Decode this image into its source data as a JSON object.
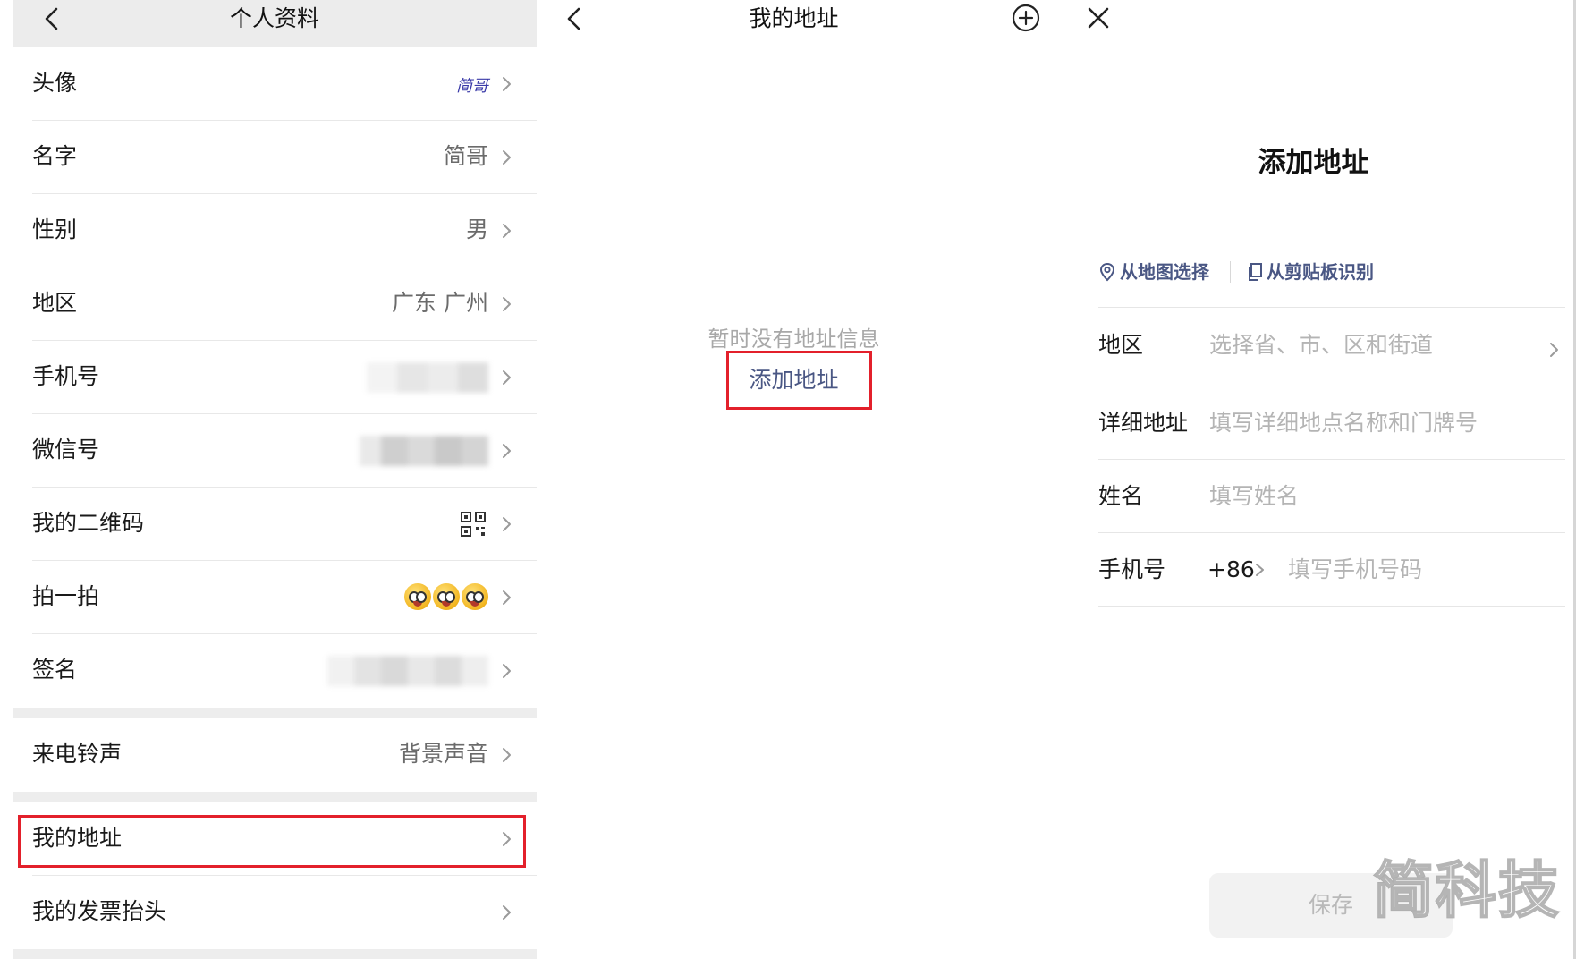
{
  "profile": {
    "title": "个人资料",
    "rows": [
      {
        "label": "头像",
        "value": "简哥"
      },
      {
        "label": "名字",
        "value": "简哥"
      },
      {
        "label": "性别",
        "value": "男"
      },
      {
        "label": "地区",
        "value": "广东 广州"
      },
      {
        "label": "手机号",
        "value": ""
      },
      {
        "label": "微信号",
        "value": ""
      },
      {
        "label": "我的二维码",
        "value": ""
      },
      {
        "label": "拍一拍",
        "value": ""
      },
      {
        "label": "签名",
        "value": ""
      },
      {
        "label": "来电铃声",
        "value": "背景声音"
      },
      {
        "label": "我的地址",
        "value": ""
      },
      {
        "label": "我的发票抬头",
        "value": ""
      }
    ]
  },
  "addresses": {
    "title": "我的地址",
    "empty_text": "暂时没有地址信息",
    "add_link": "添加地址"
  },
  "add_address": {
    "title": "添加地址",
    "from_map": "从地图选择",
    "from_clipboard": "从剪贴板识别",
    "fields": {
      "region": {
        "label": "地区",
        "placeholder": "选择省、市、区和街道"
      },
      "detail": {
        "label": "详细地址",
        "placeholder": "填写详细地点名称和门牌号"
      },
      "name": {
        "label": "姓名",
        "placeholder": "填写姓名"
      },
      "phone": {
        "label": "手机号",
        "country_code": "+86",
        "placeholder": "填写手机号码"
      }
    },
    "save_label": "保存",
    "watermark": "简科技"
  },
  "colors": {
    "highlight": "#e3202b",
    "link": "#4a5784",
    "background_gray": "#ededed"
  }
}
